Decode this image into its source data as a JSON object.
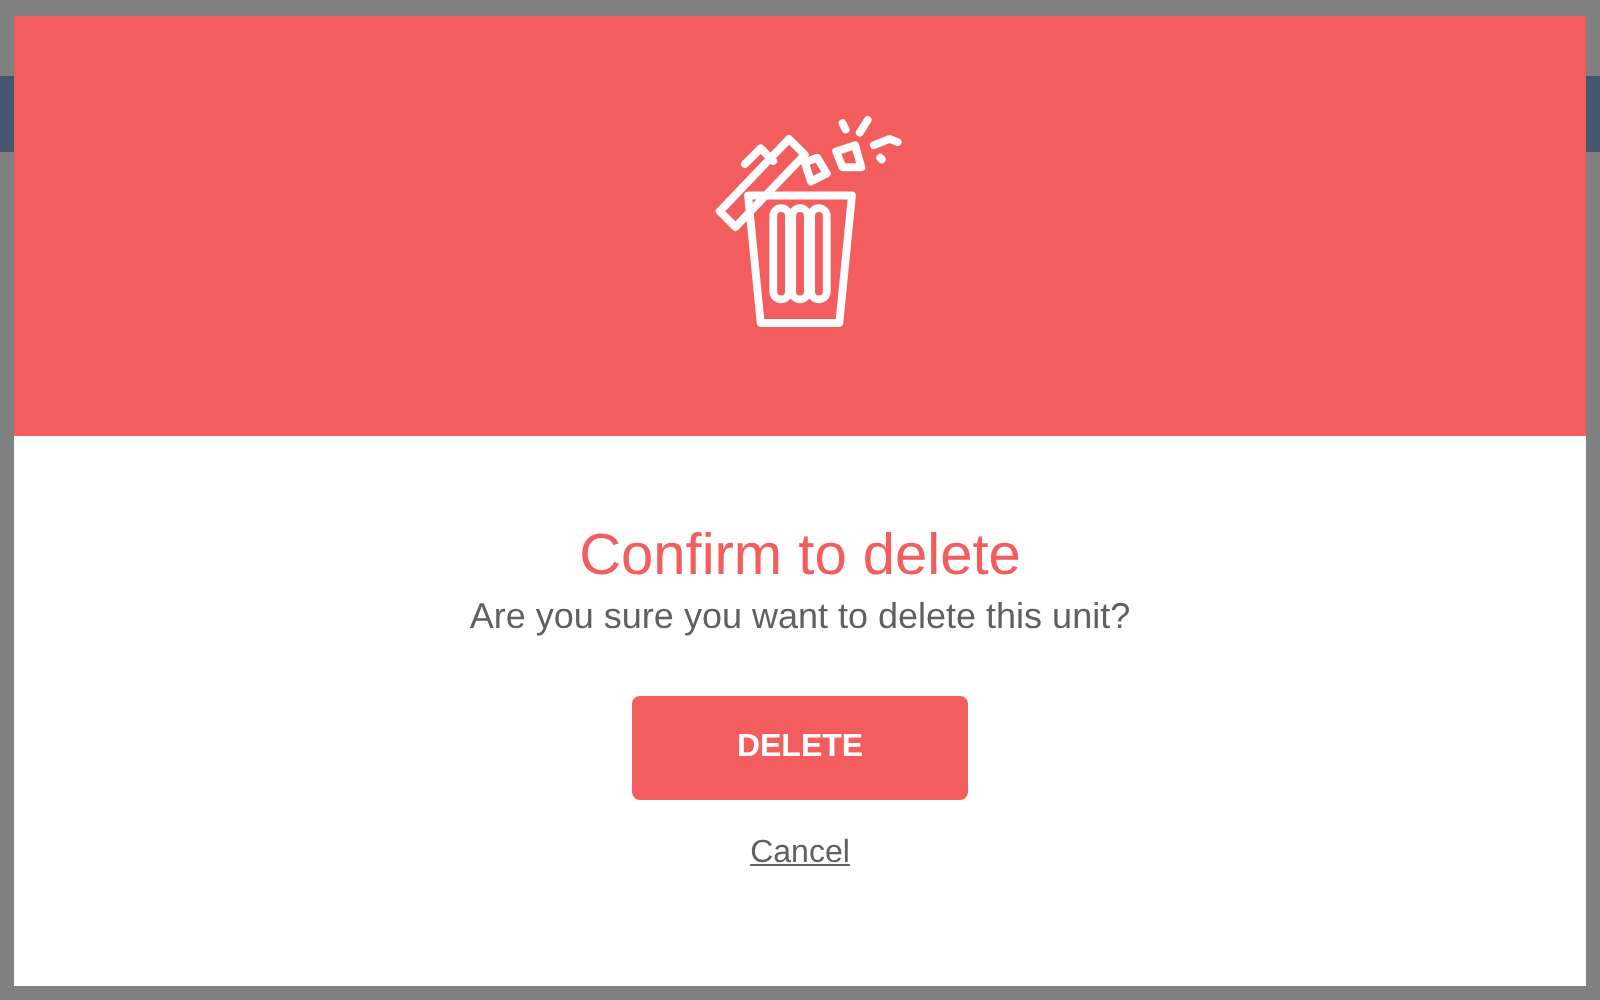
{
  "dialog": {
    "title": "Confirm to delete",
    "message": "Are you sure you want to delete this unit?",
    "confirm_button": "DELETE",
    "cancel_link": "Cancel"
  }
}
